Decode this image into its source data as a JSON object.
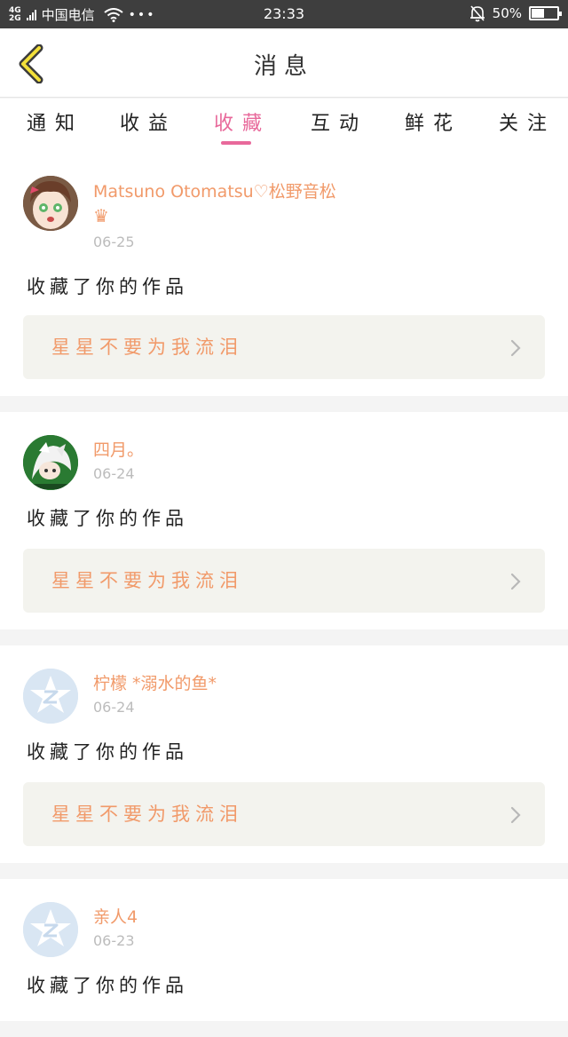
{
  "status_bar": {
    "network_top": "4G",
    "network_bottom": "2G",
    "carrier": "中国电信",
    "dots": "•••",
    "time": "23:33",
    "battery": "50%",
    "battery_level": 0.5
  },
  "navbar": {
    "title": "消息"
  },
  "tabs": {
    "items": [
      "通知",
      "收益",
      "收藏",
      "互动",
      "鲜花",
      "关注"
    ],
    "active_index": 2
  },
  "feed": [
    {
      "user": "Matsuno Otomatsu♡松野音松",
      "badge": "♛",
      "date": "06-25",
      "action": "收藏了你的作品",
      "work_title": "星星不要为我流泪",
      "avatar": "anime-girl"
    },
    {
      "user": "四月。",
      "date": "06-24",
      "action": "收藏了你的作品",
      "work_title": "星星不要为我流泪",
      "avatar": "anime-boy"
    },
    {
      "user": "柠檬 *溺水的鱼*",
      "date": "06-24",
      "action": "收藏了你的作品",
      "work_title": "星星不要为我流泪",
      "avatar": "default-qq"
    },
    {
      "user": "亲人4",
      "date": "06-23",
      "action": "收藏了你的作品",
      "avatar": "default-qq"
    }
  ],
  "colors": {
    "accent": "#e8699b",
    "username": "#f19a6a",
    "work_bg": "#f3f3ee"
  }
}
